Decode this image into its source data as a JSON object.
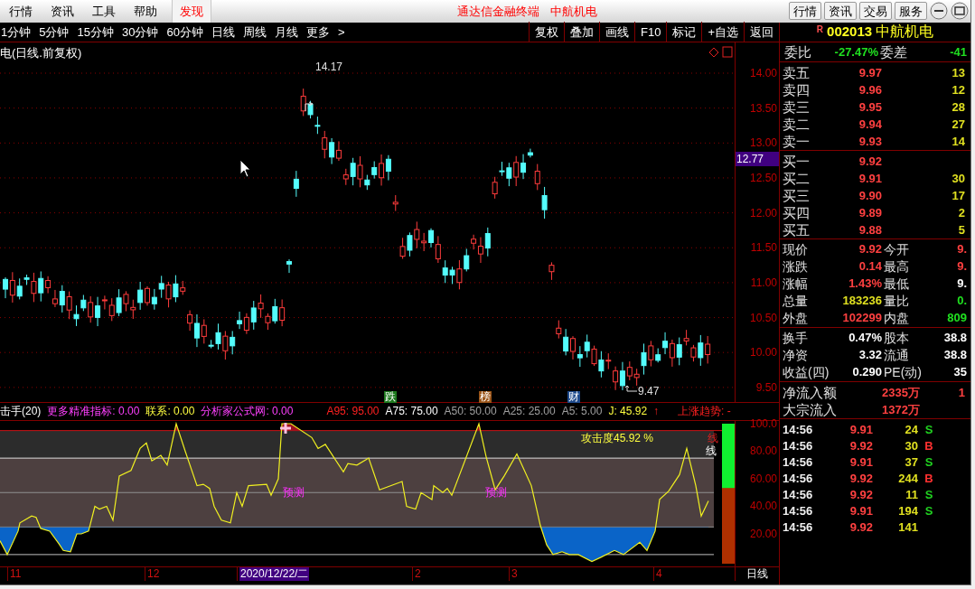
{
  "menu_bar": {
    "items": [
      "行情",
      "资讯",
      "工具",
      "帮助"
    ],
    "discover_tab": "发现",
    "title": "通达信金融终端",
    "stock_title": "中航机电",
    "buttons": [
      "行情",
      "资讯",
      "交易",
      "服务"
    ]
  },
  "period_bar": {
    "items": [
      "1分钟",
      "5分钟",
      "15分钟",
      "30分钟",
      "60分钟",
      "日线",
      "周线",
      "月线",
      "更多",
      ">"
    ],
    "tools": [
      "复权",
      "叠加",
      "画线",
      "F10",
      "标记",
      "+自选",
      "返回"
    ]
  },
  "chart": {
    "title": "电(日线.前复权)",
    "price_axis": [
      "14.00",
      "13.50",
      "13.00",
      "12.50",
      "12.00",
      "11.50",
      "11.00",
      "10.50",
      "10.00",
      "9.50"
    ],
    "price_tag": "12.77",
    "high_label": "14.17",
    "low_label": "9.47",
    "markers": [
      {
        "label": "跌",
        "color": "#1e7a1e"
      },
      {
        "label": "榜",
        "color": "#9a5418"
      },
      {
        "label": "财",
        "color": "#1e4a8c"
      }
    ]
  },
  "indicator": {
    "legend": [
      {
        "text": "击手(20)",
        "kind": "name"
      },
      {
        "text": "更多精准指标: 0.00",
        "kind": "promo"
      },
      {
        "text": "联系: 0.00",
        "kind": "value"
      },
      {
        "text": "分析家公式网: 0.00",
        "kind": "promo"
      },
      {
        "text": "A95: 95.00",
        "kind": "alert"
      },
      {
        "text": "A75: 75.00",
        "kind": "name"
      },
      {
        "text": "A50: 50.00",
        "kind": "muted"
      },
      {
        "text": "A25: 25.00",
        "kind": "muted"
      },
      {
        "text": "A5: 5.00",
        "kind": "muted"
      },
      {
        "text": "J: 45.92",
        "kind": "value"
      },
      {
        "text": "↑",
        "kind": "alert"
      },
      {
        "text": "上涨趋势: -",
        "kind": "alert"
      }
    ],
    "attack_label": "攻击度45.92 %",
    "line_labels": [
      "线",
      "线"
    ],
    "predict_labels": [
      "预测",
      "预测"
    ],
    "axis": [
      "100.0",
      "80.00",
      "60.00",
      "40.00",
      "20.00"
    ],
    "gauge": {
      "level": 0.4592
    }
  },
  "date_axis": {
    "labels": [
      "11",
      "12",
      "2020/12/22/二",
      "2",
      "3",
      "4"
    ],
    "period_label": "日线"
  },
  "quote": {
    "flag": "R",
    "code": "002013",
    "name": "中航机电",
    "ratio": [
      {
        "text": "委比",
        "color": "#e0e0e0"
      },
      {
        "text": "-27.47%",
        "color": "#20e020"
      },
      {
        "text": "委差",
        "color": "#e0e0e0"
      },
      {
        "text": "-41",
        "color": "#20e020"
      }
    ],
    "sells": [
      {
        "label": "卖五",
        "price": "9.97",
        "volume": "13"
      },
      {
        "label": "卖四",
        "price": "9.96",
        "volume": "12"
      },
      {
        "label": "卖三",
        "price": "9.95",
        "volume": "28"
      },
      {
        "label": "卖二",
        "price": "9.94",
        "volume": "27"
      },
      {
        "label": "卖一",
        "price": "9.93",
        "volume": "14"
      }
    ],
    "buys": [
      {
        "label": "买一",
        "price": "9.92"
      },
      {
        "label": "买二",
        "price": "9.91",
        "volume": "30"
      },
      {
        "label": "买三",
        "price": "9.90",
        "volume": "17"
      },
      {
        "label": "买四",
        "price": "9.89",
        "volume": "2"
      },
      {
        "label": "买五",
        "price": "9.88",
        "volume": "5"
      }
    ],
    "stats": [
      {
        "cells": [
          {
            "label": "现价",
            "value": "9.92",
            "color": "#ff4040"
          },
          {
            "label": "今开",
            "value": "9.",
            "color": "#ff4040"
          }
        ]
      },
      {
        "cells": [
          {
            "label": "涨跌",
            "value": "0.14",
            "color": "#ff4040"
          },
          {
            "label": "最高",
            "value": "9.",
            "color": "#ff4040"
          }
        ]
      },
      {
        "cells": [
          {
            "label": "涨幅",
            "value": "1.43%",
            "color": "#ff4040"
          },
          {
            "label": "最低",
            "value": "9.",
            "color": "#ffffff"
          }
        ]
      },
      {
        "cells": [
          {
            "label": "总量",
            "value": "183236",
            "color": "#e0e020"
          },
          {
            "label": "量比",
            "value": "0.",
            "color": "#20e020"
          }
        ]
      },
      {
        "cells": [
          {
            "label": "外盘",
            "value": "102299",
            "color": "#ff4040"
          },
          {
            "label": "内盘",
            "value": "809",
            "color": "#20e020"
          }
        ]
      }
    ],
    "capital": [
      {
        "cells": [
          {
            "label": "换手",
            "value": "0.47%"
          },
          {
            "label": "股本",
            "value": "38.8"
          }
        ]
      },
      {
        "cells": [
          {
            "label": "净资",
            "value": "3.32"
          },
          {
            "label": "流通",
            "value": "38.8"
          }
        ]
      },
      {
        "cells": [
          {
            "label": "收益(四)",
            "value": "0.290"
          },
          {
            "label": "PE(动)",
            "value": "35"
          }
        ]
      }
    ],
    "flows": [
      {
        "label": "净流入额",
        "value": "2335万",
        "value2": "1"
      },
      {
        "label": "大宗流入",
        "value": "1372万"
      }
    ],
    "ticks": [
      {
        "time": "14:56",
        "price": "9.91",
        "volume": "24",
        "side": "S",
        "kind": "sell"
      },
      {
        "time": "14:56",
        "price": "9.92",
        "volume": "30",
        "side": "B",
        "kind": "buy"
      },
      {
        "time": "14:56",
        "price": "9.91",
        "volume": "37",
        "side": "S",
        "kind": "sell"
      },
      {
        "time": "14:56",
        "price": "9.92",
        "volume": "244",
        "side": "B",
        "kind": "buy"
      },
      {
        "time": "14:56",
        "price": "9.92",
        "volume": "11",
        "side": "S",
        "kind": "sell"
      },
      {
        "time": "14:56",
        "price": "9.91",
        "volume": "194",
        "side": "S",
        "kind": "sell"
      },
      {
        "time": "14:56",
        "price": "9.92",
        "volume": "141"
      }
    ]
  }
}
